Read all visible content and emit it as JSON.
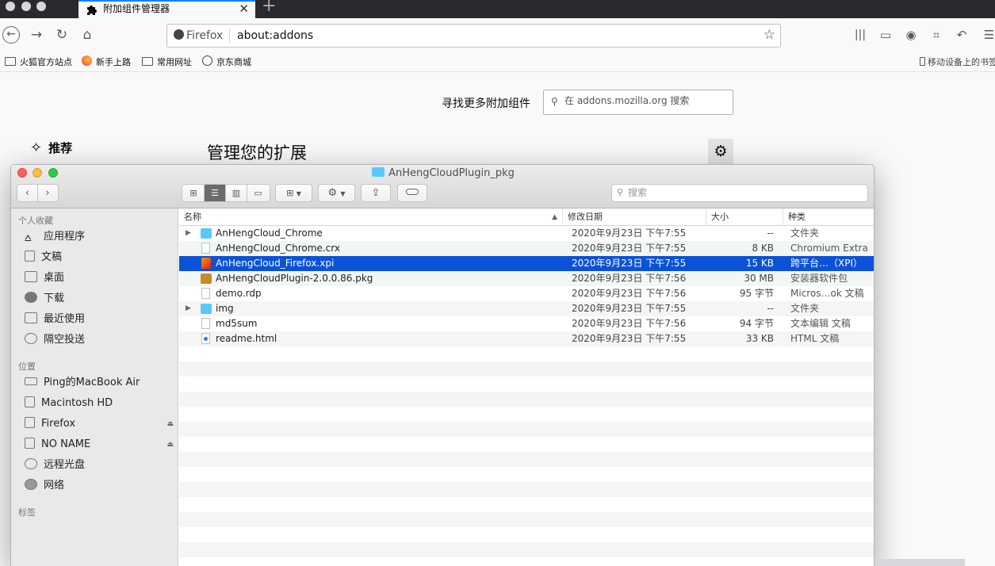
{
  "browser": {
    "tab_title": "附加组件管理器",
    "identity_label": "Firefox",
    "url": "about:addons",
    "bookmarks": [
      "火狐官方站点",
      "新手上路",
      "常用网址",
      "京东商城"
    ],
    "mobile_bookmarks": "移动设备上的书签"
  },
  "addons_page": {
    "find_more_label": "寻找更多附加组件",
    "search_placeholder": "在 addons.mozilla.org 搜索",
    "nav_recommend": "推荐",
    "manage_title": "管理您的扩展"
  },
  "finder": {
    "title": "AnHengCloudPlugin_pkg",
    "search_placeholder": "搜索",
    "sidebar": {
      "favorites_header": "个人收藏",
      "favorites": [
        "应用程序",
        "文稿",
        "桌面",
        "下载",
        "最近使用",
        "隔空投送"
      ],
      "locations_header": "位置",
      "locations": [
        "Ping的MacBook Air",
        "Macintosh HD",
        "Firefox",
        "NO NAME",
        "远程光盘",
        "网络"
      ],
      "tags_header": "标签"
    },
    "columns": {
      "name": "名称",
      "date": "修改日期",
      "size": "大小",
      "kind": "种类"
    },
    "files": [
      {
        "name": "AnHengCloud_Chrome",
        "date": "2020年9月23日 下午7:55",
        "size": "--",
        "kind": "文件夹",
        "icon": "folder",
        "expandable": true,
        "selected": false
      },
      {
        "name": "AnHengCloud_Chrome.crx",
        "date": "2020年9月23日 下午7:55",
        "size": "8 KB",
        "kind": "Chromium Extra",
        "icon": "doc",
        "expandable": false,
        "selected": false
      },
      {
        "name": "AnHengCloud_Firefox.xpi",
        "date": "2020年9月23日 下午7:55",
        "size": "15 KB",
        "kind": "跨平台…（XPI）",
        "icon": "xpi",
        "expandable": false,
        "selected": true
      },
      {
        "name": "AnHengCloudPlugin-2.0.0.86.pkg",
        "date": "2020年9月23日 下午7:56",
        "size": "30 MB",
        "kind": "安装器软件包",
        "icon": "pkg",
        "expandable": false,
        "selected": false
      },
      {
        "name": "demo.rdp",
        "date": "2020年9月23日 下午7:56",
        "size": "95 字节",
        "kind": "Micros…ok 文稿",
        "icon": "doc",
        "expandable": false,
        "selected": false
      },
      {
        "name": "img",
        "date": "2020年9月23日 下午7:55",
        "size": "--",
        "kind": "文件夹",
        "icon": "folder",
        "expandable": true,
        "selected": false
      },
      {
        "name": "md5sum",
        "date": "2020年9月23日 下午7:56",
        "size": "94 字节",
        "kind": "文本编辑 文稿",
        "icon": "doc",
        "expandable": false,
        "selected": false
      },
      {
        "name": "readme.html",
        "date": "2020年9月23日 下午7:55",
        "size": "33 KB",
        "kind": "HTML 文稿",
        "icon": "html",
        "expandable": false,
        "selected": false
      }
    ]
  },
  "colors": {
    "selection": "#0b52d8",
    "folder": "#5ac8fa",
    "firefox_accent": "#0a84ff"
  }
}
